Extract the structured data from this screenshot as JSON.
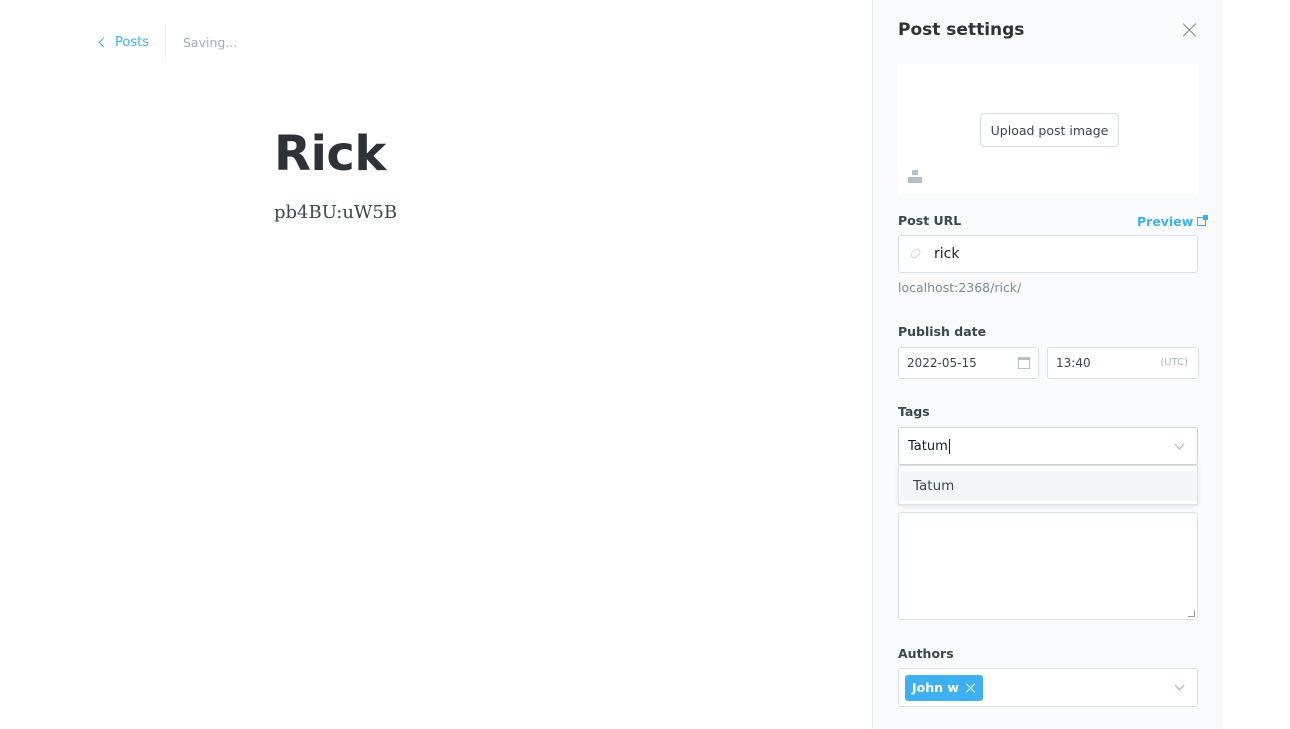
{
  "editor": {
    "back_label": "Posts",
    "status": "Saving...",
    "title": "Rick",
    "body": "pb4BU:uW5B"
  },
  "panel": {
    "title": "Post settings",
    "upload_label": "Upload post image",
    "post_url_label": "Post URL",
    "preview_label": "Preview",
    "slug": "rick",
    "url_hint": "localhost:2368/rick/",
    "publish_date_label": "Publish date",
    "date": "2022-05-15",
    "time": "13:40",
    "timezone": "(UTC)",
    "tags_label": "Tags",
    "tags_input": "Tatum",
    "tag_suggestion": "Tatum",
    "authors_label": "Authors",
    "author_chip": "John w"
  },
  "colors": {
    "accent": "#3eb0ef",
    "panel_bg": "#f8fafb",
    "text_dark": "#2c3238"
  },
  "icons": [
    "chevron-left-icon",
    "close-icon",
    "unsplash-icon",
    "external-link-icon",
    "link-icon",
    "calendar-icon",
    "chevron-down-icon",
    "remove-icon"
  ]
}
